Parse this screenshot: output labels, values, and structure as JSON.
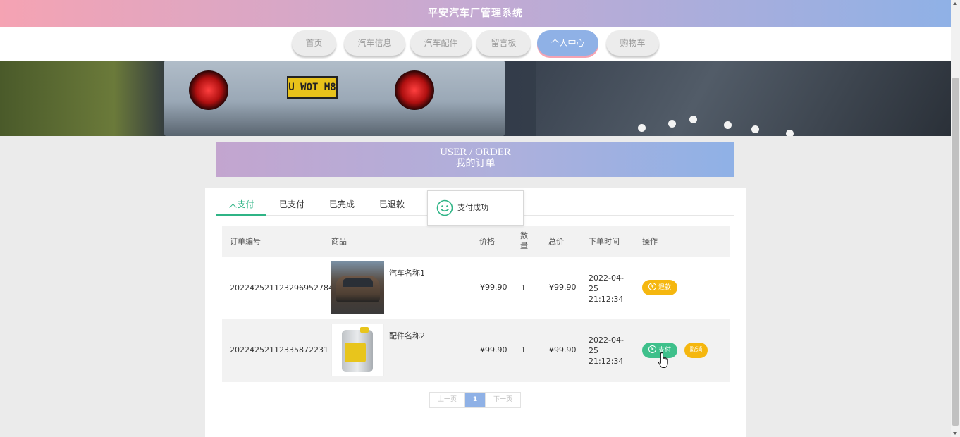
{
  "header": {
    "title": "平安汽车厂管理系统"
  },
  "nav": [
    {
      "label": "首页",
      "active": false
    },
    {
      "label": "汽车信息",
      "active": false
    },
    {
      "label": "汽车配件",
      "active": false
    },
    {
      "label": "留言板",
      "active": false
    },
    {
      "label": "个人中心",
      "active": true
    },
    {
      "label": "购物车",
      "active": false
    }
  ],
  "banner": {
    "plate": "U WOT M8"
  },
  "section": {
    "title_en": "USER / ORDER",
    "title_cn": "我的订单"
  },
  "tabs": [
    {
      "label": "未支付",
      "active": true
    },
    {
      "label": "已支付",
      "active": false
    },
    {
      "label": "已完成",
      "active": false
    },
    {
      "label": "已退款",
      "active": false
    }
  ],
  "toast": {
    "message": "支付成功"
  },
  "table": {
    "columns": [
      "订单编号",
      "商品",
      "价格",
      "数量",
      "总价",
      "下单时间",
      "操作"
    ],
    "rows": [
      {
        "order_no": "20224252112329695278​4",
        "product": "汽车名称1",
        "price": "¥99.90",
        "qty": "1",
        "total": "¥99.90",
        "time_date": "2022-04-",
        "time_day": "25",
        "time_clock": "21:12:34",
        "actions": [
          {
            "label": "退款",
            "color": "#f5b70f",
            "icon": "yen-icon"
          }
        ]
      },
      {
        "order_no": "20224252112335872231",
        "product": "配件名称2",
        "price": "¥99.90",
        "qty": "1",
        "total": "¥99.90",
        "time_date": "2022-04-",
        "time_day": "25",
        "time_clock": "21:12:34",
        "actions": [
          {
            "label": "支付",
            "color": "#3ec08b",
            "icon": "yen-icon"
          },
          {
            "label": "取消",
            "color": "#f5b70f"
          }
        ]
      }
    ]
  },
  "pager": {
    "prev": "上一页",
    "current": "1",
    "next": "下一页"
  },
  "icons": {
    "yen": "¥"
  },
  "colors": {
    "accent": "#8fb1e6",
    "pink": "#f5a3b3",
    "green": "#3ec08b",
    "orange": "#f5b70f"
  }
}
